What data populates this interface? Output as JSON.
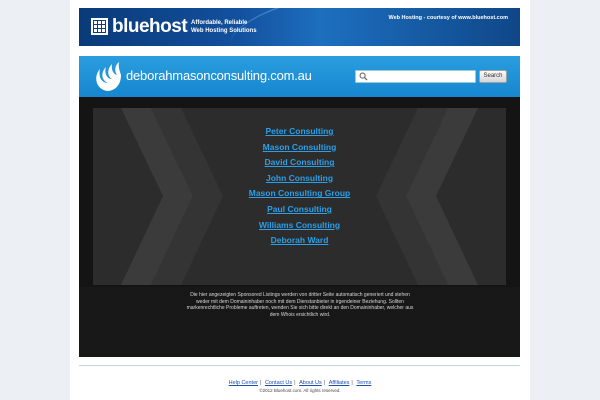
{
  "banner": {
    "logo_text": "bluehost",
    "tagline_line1": "Affordable, Reliable",
    "tagline_line2": "Web Hosting Solutions",
    "courtesy": "Web Hosting - courtesy of www.bluehost.com"
  },
  "header": {
    "domain": "deborahmasonconsulting.com.au",
    "search_placeholder": "",
    "search_button": "Search"
  },
  "links": [
    "Peter Consulting",
    "Mason Consulting",
    "David Consulting",
    "John Consulting",
    "Mason Consulting Group",
    "Paul Consulting",
    "Williams Consulting",
    "Deborah Ward"
  ],
  "disclaimer": "Die hier angezeigten Sponsored Listings werden von dritter Seite automatisch generiert und stehen weder mit dem Domaininhaber noch mit dem Dienstanbieter in irgendeiner Beziehung. Sollten markenrechtliche Probleme auftreten, wenden Sie sich bitte direkt an den Domaininhaber, welcher aus dem Whois ersichtlich wird.",
  "footer": {
    "links": [
      "Help Center",
      "Contact Us",
      "About Us",
      "Affiliates",
      "Terms"
    ],
    "separator": "|",
    "copyright": "©2012 Bluehost.com. All rights reserved."
  },
  "colors": {
    "link": "#2b9fe8",
    "header_blue": "#1686cf",
    "banner_blue": "#124f9c",
    "dark_bg": "#141414"
  }
}
